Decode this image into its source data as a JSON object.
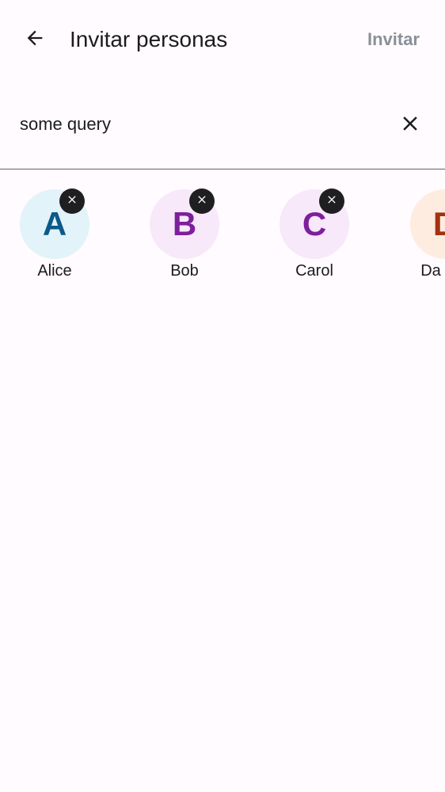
{
  "header": {
    "back_icon": "arrow-back-icon",
    "title": "Invitar personas",
    "invite_label": "Invitar",
    "invite_color": "#8a9098"
  },
  "search": {
    "value": "some query",
    "clear_icon": "close-icon"
  },
  "selected_people": [
    {
      "initial": "A",
      "name": "Alice",
      "avatar_bg": "#e2f3f9",
      "avatar_fg": "#0b5a8a",
      "remove_icon": "remove-circle-icon"
    },
    {
      "initial": "B",
      "name": "Bob",
      "avatar_bg": "#f7e8fa",
      "avatar_fg": "#7e1f9b",
      "remove_icon": "remove-circle-icon"
    },
    {
      "initial": "C",
      "name": "Carol",
      "avatar_bg": "#f7e8fa",
      "avatar_fg": "#7e1f9b",
      "remove_icon": "remove-circle-icon"
    },
    {
      "initial": "D",
      "name": "Da",
      "avatar_bg": "#feece1",
      "avatar_fg": "#a3320f",
      "remove_icon": "remove-circle-icon"
    }
  ]
}
